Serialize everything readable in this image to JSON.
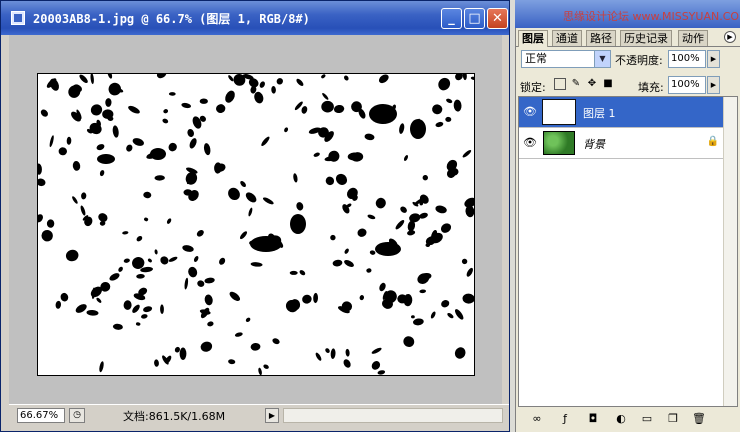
{
  "document_window": {
    "title": "20003AB8-1.jpg @ 66.7% (图层 1, RGB/8#)",
    "minimize_label": "_",
    "maximize_label": "□",
    "close_label": "✕"
  },
  "status_bar": {
    "zoom": "66.67%",
    "doc_info": "文档:861.5K/1.68M"
  },
  "watermark": "思缘设计论坛 www.MISSYUAN.COM",
  "layers_panel": {
    "tabs": [
      "图层",
      "通道",
      "路径",
      "历史记录",
      "动作"
    ],
    "blend_mode": "正常",
    "opacity_label": "不透明度:",
    "opacity_value": "100%",
    "lock_label": "锁定:",
    "fill_label": "填充:",
    "fill_value": "100%",
    "layers": [
      {
        "name": "图层 1",
        "selected": true,
        "visible": true
      },
      {
        "name": "背景",
        "selected": false,
        "visible": true,
        "locked": true
      }
    ]
  },
  "colors": {
    "title_bar": "#2850b8",
    "selection": "#3466c8",
    "canvas_bg": "#c0c0c0"
  }
}
